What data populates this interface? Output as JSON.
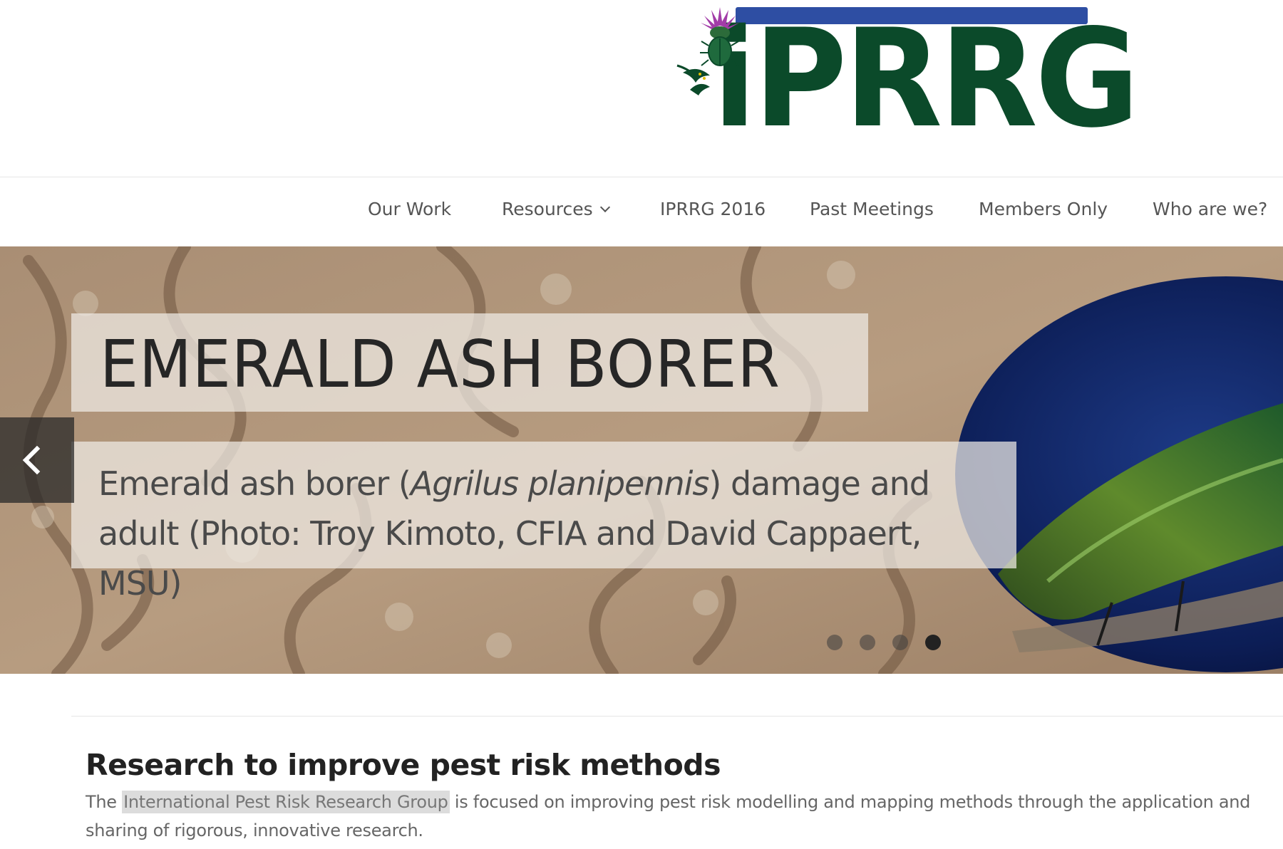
{
  "logo": {
    "text": "iPRRG",
    "bar_color": "#2e4ea3",
    "text_color": "#0b4a2a"
  },
  "nav": {
    "items": [
      {
        "label": "Our Work"
      },
      {
        "label": "Resources",
        "has_dropdown": true
      },
      {
        "label": "IPRRG 2016"
      },
      {
        "label": "Past Meetings"
      },
      {
        "label": "Members Only"
      },
      {
        "label": "Who are we?"
      }
    ]
  },
  "hero": {
    "title": "EMERALD ASH BORER",
    "caption_before": "Emerald ash borer (",
    "caption_italic": "Agrilus planipennis",
    "caption_after": ") damage and adult (Photo: Troy Kimoto, CFIA and David Cappaert, MSU)",
    "prev_icon": "chevron-left-icon",
    "slides": 4,
    "active_slide": 4
  },
  "content": {
    "title": "Research to improve pest risk methods",
    "body_before": "The ",
    "body_link": "International Pest Risk Research Group",
    "body_after": " is focused on improving pest risk modelling and mapping methods through the application and sharing of rigorous, innovative research."
  }
}
